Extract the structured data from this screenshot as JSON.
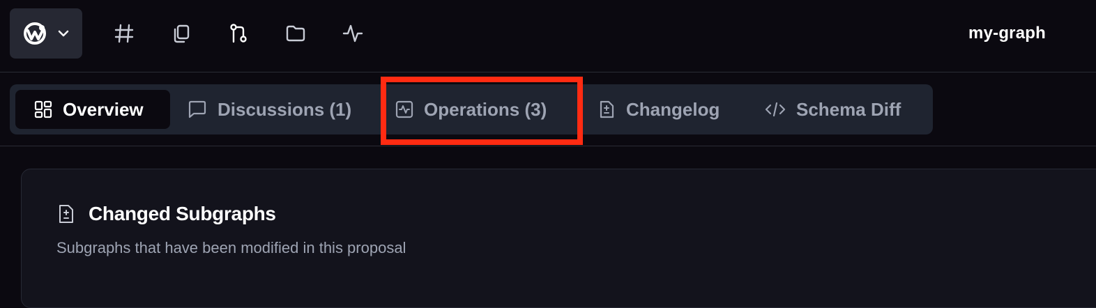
{
  "header": {
    "graph_name": "my-graph",
    "logo_icon": "wundergraph-logo-icon",
    "nav_icons": [
      "hash-icon",
      "copy-icon",
      "git-pull-request-icon",
      "folder-icon",
      "activity-icon"
    ]
  },
  "tabs": [
    {
      "label": "Overview",
      "icon": "layout-grid-icon",
      "active": true
    },
    {
      "label": "Discussions (1)",
      "icon": "message-square-icon",
      "active": false
    },
    {
      "label": "Operations (3)",
      "icon": "activity-square-icon",
      "active": false
    },
    {
      "label": "Changelog",
      "icon": "file-diff-icon",
      "active": false
    },
    {
      "label": "Schema Diff",
      "icon": "code-icon",
      "active": false
    }
  ],
  "card": {
    "title": "Changed Subgraphs",
    "subtitle": "Subgraphs that have been modified in this proposal"
  },
  "colors": {
    "background": "#0b0910",
    "tabs_bg": "#1f2430",
    "highlight": "#ff2b12",
    "card_bg": "#13131c"
  }
}
